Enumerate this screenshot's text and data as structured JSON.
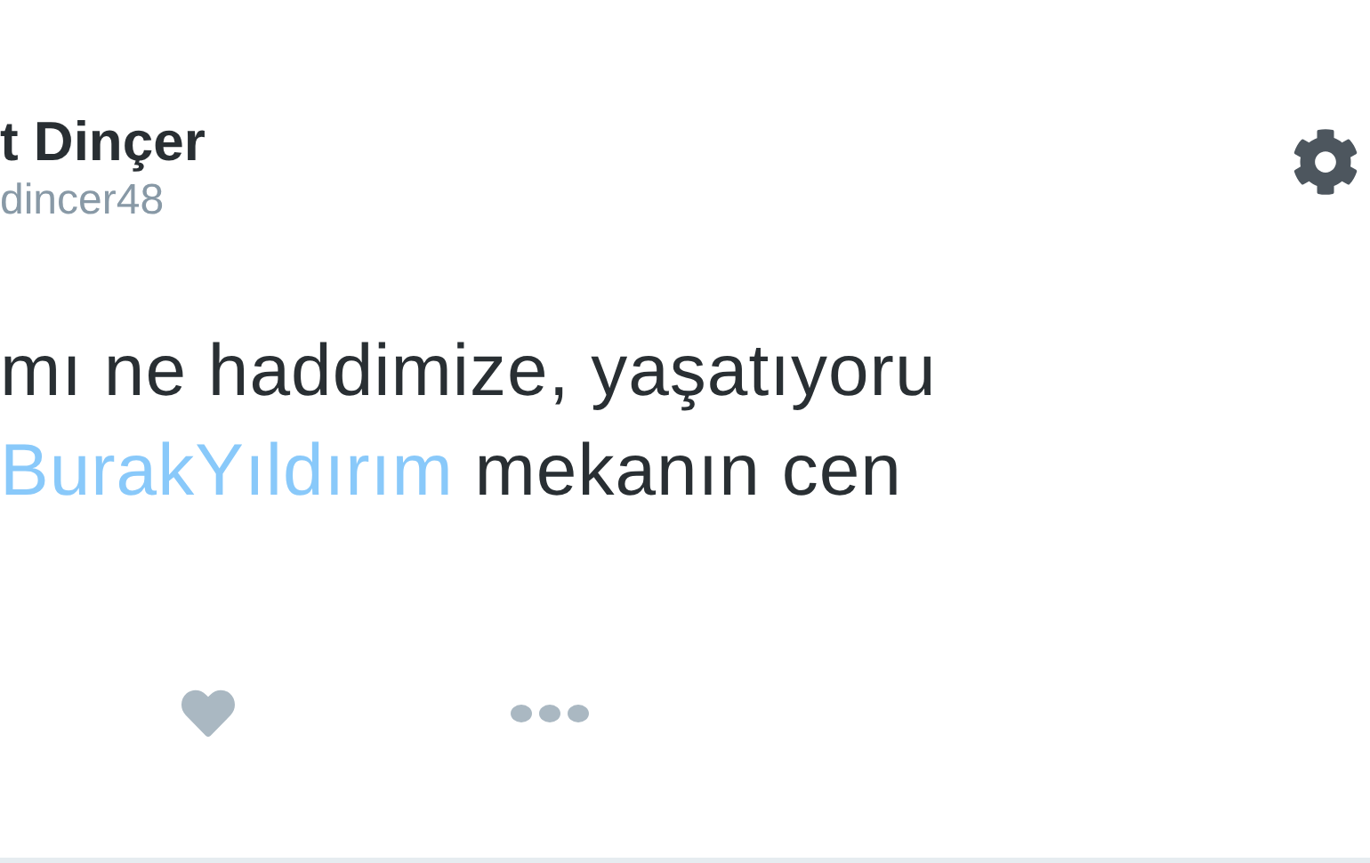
{
  "author": {
    "name": "t Dinçer",
    "handle": "dincer48"
  },
  "tweet": {
    "lines": [
      [
        {
          "kind": "text",
          "text": "mı ne haddimize, yaşatıyoru"
        }
      ],
      [
        {
          "kind": "hashtag",
          "text": "BurakYıldırım"
        },
        {
          "kind": "text",
          "text": " mekanın cen"
        }
      ]
    ]
  }
}
